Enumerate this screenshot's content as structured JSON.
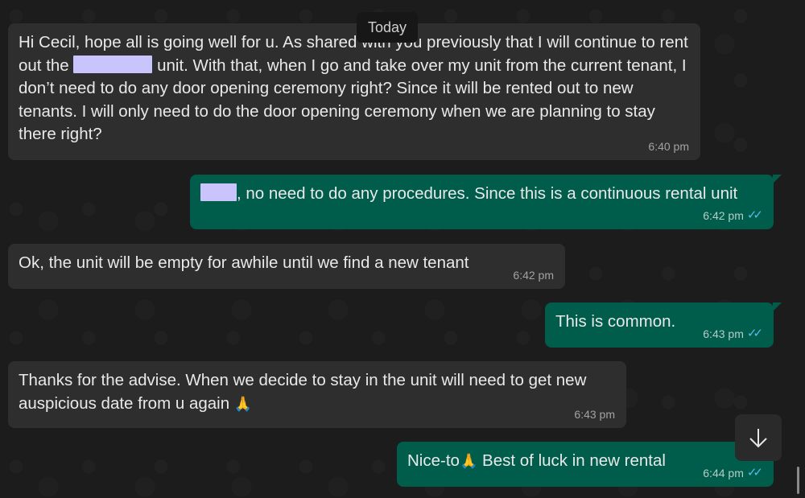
{
  "date_divider": "Today",
  "messages": [
    {
      "direction": "incoming",
      "text_a": "Hi Cecil, hope all is going well for u. As shared with you previously that I will continue to rent out the",
      "text_b": "unit. With that, when I go and take over my unit from the current tenant, I don’t need to do any door opening ceremony right? Since it will be rented out to new tenants. I will only need to do the door opening ceremony when we are planning to stay there right?",
      "time": "6:40 pm"
    },
    {
      "direction": "outgoing",
      "text": ", no need to do any procedures. Since this is a continuous rental unit",
      "time": "6:42 pm",
      "read": true
    },
    {
      "direction": "incoming",
      "text": "Ok, the unit will be empty for awhile until we find a new tenant",
      "time": "6:42 pm"
    },
    {
      "direction": "outgoing",
      "text": "This is common.",
      "time": "6:43 pm",
      "read": true
    },
    {
      "direction": "incoming",
      "text": "Thanks for the advise. When we decide to stay in the unit will need to get new auspicious date from u again",
      "emoji": "🙏",
      "time": "6:43 pm"
    },
    {
      "direction": "outgoing",
      "text_a": "Nice-to",
      "emoji": "🙏",
      "text_b": " Best of luck in new rental",
      "time": "6:44 pm",
      "read": true
    }
  ],
  "read_receipt_icon": "double-check-icon",
  "scroll_to_bottom_icon": "arrow-down-icon",
  "colors": {
    "incoming_bubble": "#2e2e2e",
    "outgoing_bubble": "#005c4b",
    "read_ticks": "#53bdeb",
    "redaction": "#c9c4fb"
  }
}
